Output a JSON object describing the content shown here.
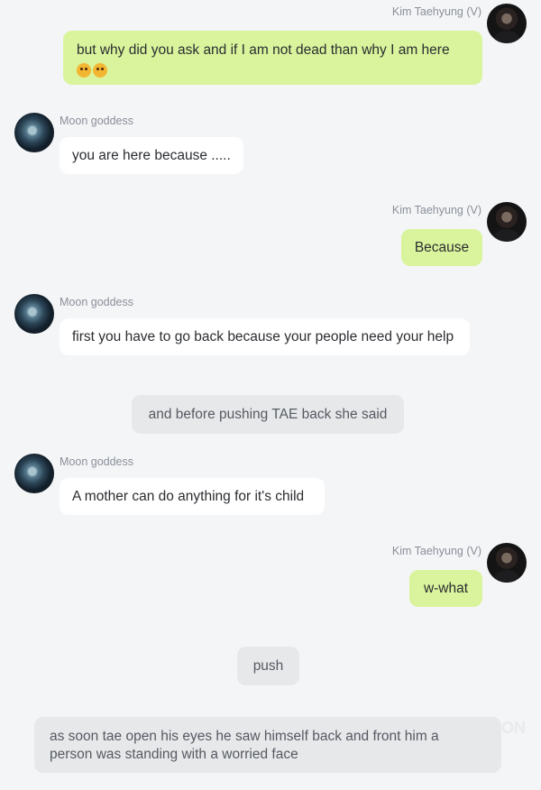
{
  "messages": [
    {
      "sender": "Kim Taehyung (V)",
      "text": "but why did you ask and if I am not dead than why I am here"
    },
    {
      "sender": "Moon goddess",
      "text": "you are here because ....."
    },
    {
      "sender": "Kim Taehyung (V)",
      "text": "Because"
    },
    {
      "sender": "Moon goddess",
      "text": "first you have to go back because your people need your help"
    },
    {
      "narration": "and before pushing TAE back she said"
    },
    {
      "sender": "Moon goddess",
      "text": "A mother can do anything for it's child"
    },
    {
      "sender": "Kim Taehyung (V)",
      "text": "w-what"
    },
    {
      "narration": "push"
    },
    {
      "narration": "as soon tae open his eyes he saw himself back and front him a person was standing with a worried face"
    }
  ],
  "emojis": [
    "kissing-face-icon",
    "blushing-face-icon"
  ],
  "watermark": "ON",
  "colors": {
    "background": "#f4f5f7",
    "sent_bubble": "#d9f49c",
    "received_bubble": "#ffffff",
    "narration_bubble": "#e7e8ea"
  }
}
